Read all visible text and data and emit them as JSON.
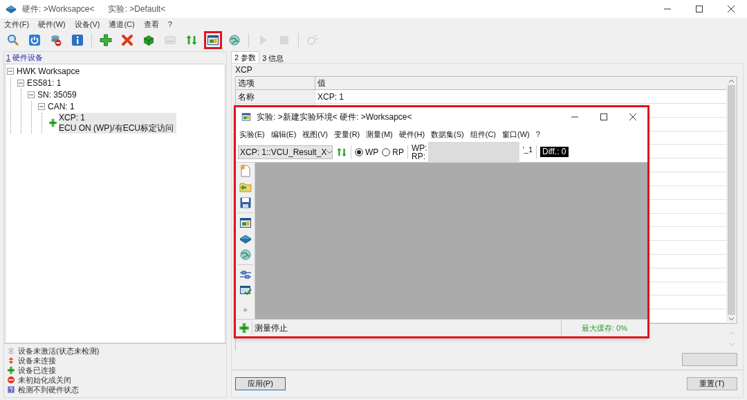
{
  "window": {
    "title": "硬件: >Worksapce<",
    "subtitle": "实验: >Default<"
  },
  "menu": [
    "文件(F)",
    "硬件(W)",
    "设备(V)",
    "通道(C)",
    "查看",
    "?"
  ],
  "toolbar": [
    {
      "kind": "search",
      "disabled": false,
      "highlighted": false
    },
    {
      "kind": "power",
      "disabled": false,
      "highlighted": false
    },
    {
      "kind": "unplug",
      "disabled": false,
      "highlighted": false
    },
    {
      "kind": "info",
      "disabled": false,
      "highlighted": false
    },
    {
      "kind": "sep"
    },
    {
      "kind": "add",
      "disabled": false,
      "highlighted": false
    },
    {
      "kind": "delete",
      "disabled": false,
      "highlighted": false
    },
    {
      "kind": "cube",
      "disabled": false,
      "highlighted": false
    },
    {
      "kind": "card",
      "disabled": true,
      "highlighted": false
    },
    {
      "kind": "updown",
      "disabled": false,
      "highlighted": false
    },
    {
      "kind": "window",
      "disabled": false,
      "highlighted": true
    },
    {
      "kind": "globe",
      "disabled": false,
      "highlighted": false
    },
    {
      "kind": "sep"
    },
    {
      "kind": "play",
      "disabled": true,
      "highlighted": false
    },
    {
      "kind": "stop",
      "disabled": true,
      "highlighted": false
    },
    {
      "kind": "sep"
    },
    {
      "kind": "network",
      "disabled": true,
      "highlighted": false
    }
  ],
  "left_tab": {
    "number": "1",
    "label": "硬件设备"
  },
  "tree": [
    {
      "label": "HWK Worksapce",
      "expanded": true,
      "children": [
        {
          "label": "ES581: 1",
          "expanded": true,
          "children": [
            {
              "label": "SN:  35059",
              "expanded": true,
              "children": [
                {
                  "label": "CAN: 1",
                  "expanded": true,
                  "children": [
                    {
                      "label": "XCP: 1",
                      "detail": "ECU ON (WP)/有ECU标定访问",
                      "kind": "connected",
                      "selected": true
                    }
                  ]
                }
              ]
            }
          ]
        }
      ]
    }
  ],
  "legend": [
    {
      "kind": "inactive",
      "label": "设备未激活(状态未检测)"
    },
    {
      "kind": "disconnected",
      "label": "设备未连接"
    },
    {
      "kind": "connected",
      "label": "设备已连接"
    },
    {
      "kind": "closed",
      "label": "未初始化或关闭"
    },
    {
      "kind": "unknown",
      "label": "检测不到硬件状态"
    }
  ],
  "tabs": [
    {
      "label": "2 参数",
      "selected": true
    },
    {
      "label": "3 信息",
      "selected": false
    }
  ],
  "section": "XCP",
  "table": {
    "columns": [
      "选项",
      "值"
    ],
    "rows": [
      [
        "名称",
        "XCP: 1"
      ]
    ]
  },
  "buttons": {
    "apply": "应用(P)",
    "reset": "重置(T)"
  },
  "experiment_window": {
    "title": "实验: >新建实验环境< 硬件: >Worksapce<",
    "menu": [
      "实验(E)",
      "编辑(E)",
      "视图(V)",
      "变量(R)",
      "测量(M)",
      "硬件(H)",
      "数据集(S)",
      "组件(C)",
      "窗口(W)",
      "?"
    ],
    "combo": "XCP: 1::VCU_Result_X",
    "pages": [
      {
        "label": "WP",
        "selected": true
      },
      {
        "label": "RP",
        "selected": false
      }
    ],
    "wp_label": "WP:",
    "rp_label": "RP:",
    "page_suffix": "'_1",
    "diff": "Diff.: 0",
    "side_tools": [
      {
        "kind": "new"
      },
      {
        "kind": "folder"
      },
      {
        "kind": "save"
      },
      {
        "kind": "sep"
      },
      {
        "kind": "window"
      },
      {
        "kind": "layer"
      },
      {
        "kind": "globe"
      },
      {
        "kind": "sep"
      },
      {
        "kind": "sliders"
      },
      {
        "kind": "checkscreen"
      },
      {
        "kind": "more",
        "label": "»"
      }
    ],
    "status": "测量停止",
    "buffer": "最大缓存: 0%"
  }
}
